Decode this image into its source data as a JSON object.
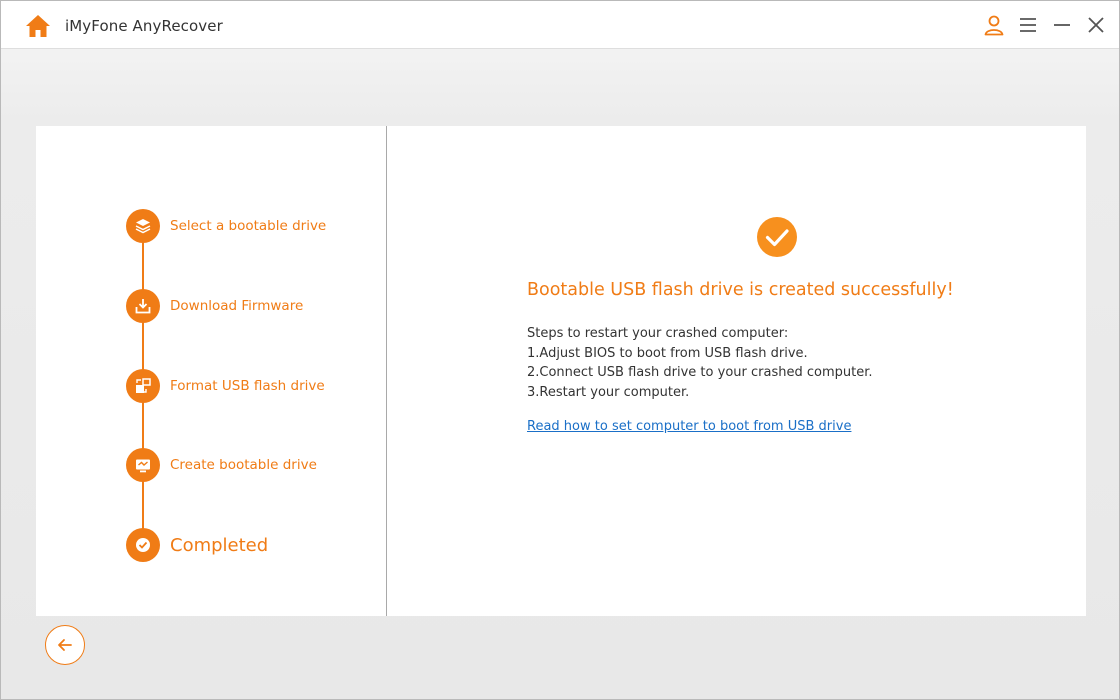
{
  "app": {
    "title": "iMyFone AnyRecover"
  },
  "titlebar": {
    "icons": [
      "home-icon",
      "user-icon",
      "menu-icon",
      "minimize-icon",
      "close-icon"
    ]
  },
  "steps": [
    {
      "label": "Select a bootable drive",
      "icon": "layers-icon"
    },
    {
      "label": "Download Firmware",
      "icon": "download-icon"
    },
    {
      "label": "Format USB flash drive",
      "icon": "format-icon"
    },
    {
      "label": "Create bootable drive",
      "icon": "create-drive-icon"
    },
    {
      "label": "Completed",
      "icon": "check-icon"
    }
  ],
  "result": {
    "headline": "Bootable USB flash drive is created successfully!",
    "intro": "Steps to restart your crashed computer:",
    "steps": [
      "1.Adjust BIOS to boot from USB flash drive.",
      "2.Connect USB flash drive to your crashed computer.",
      "3.Restart your computer."
    ],
    "link": "Read how to set computer to boot from USB drive"
  },
  "colors": {
    "accent": "#f07c16",
    "link": "#1a6fc7",
    "text": "#333333"
  }
}
